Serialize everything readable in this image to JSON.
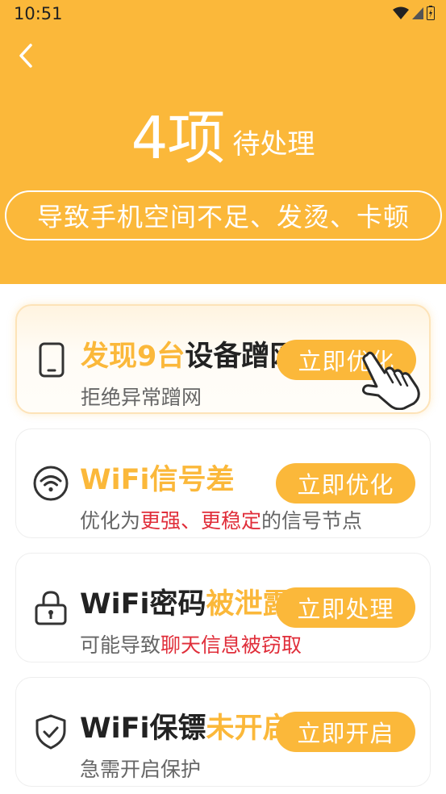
{
  "status": {
    "time": "10:51"
  },
  "header": {
    "count": "4项",
    "count_suffix": "待处理",
    "warning": "导致手机空间不足、发烫、卡顿"
  },
  "cards": [
    {
      "title_highlight": "发现9台",
      "title_rest": "设备蹭网",
      "subtitle": "拒绝异常蹭网",
      "button": "立即优化",
      "icon": "phone-icon"
    },
    {
      "title_highlight": "WiFi信号差",
      "subtitle_prefix": "优化为",
      "subtitle_red": "更强、更稳定",
      "subtitle_suffix": "的信号节点",
      "button": "立即优化",
      "icon": "wifi-icon"
    },
    {
      "title_plain": "WiFi密码",
      "title_highlight": "被泄露",
      "subtitle_prefix": "可能导致",
      "subtitle_red": "聊天信息被窃取",
      "button": "立即处理",
      "icon": "lock-icon"
    },
    {
      "title_plain": "WiFi保镖",
      "title_highlight": "未开启",
      "subtitle": "急需开启保护",
      "button": "立即开启",
      "icon": "shield-check-icon"
    }
  ],
  "colors": {
    "accent": "#FBB83A",
    "alert": "#E02E3A"
  }
}
